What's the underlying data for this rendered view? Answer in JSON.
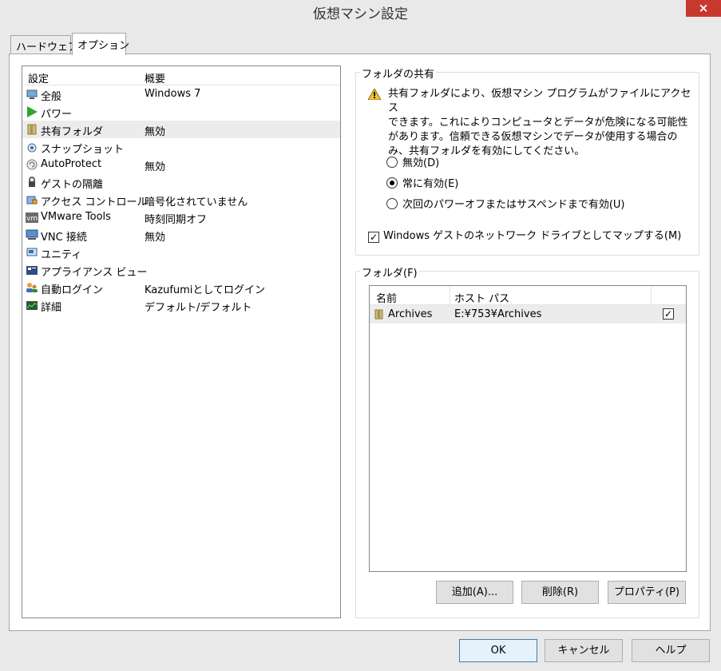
{
  "window": {
    "title": "仮想マシン設定",
    "close_label": "×"
  },
  "tabs": [
    {
      "label": "ハードウェア"
    },
    {
      "label": "オプション"
    }
  ],
  "settings": {
    "headers": {
      "setting": "設定",
      "summary": "概要"
    },
    "items": [
      {
        "name": "全般",
        "summary": "Windows 7",
        "icon": "monitor-icon"
      },
      {
        "name": "パワー",
        "summary": "",
        "icon": "play-icon"
      },
      {
        "name": "共有フォルダ",
        "summary": "無効",
        "icon": "folder-icon"
      },
      {
        "name": "スナップショット",
        "summary": "",
        "icon": "snapshot-icon"
      },
      {
        "name": "AutoProtect",
        "summary": "無効",
        "icon": "autoprotect-icon"
      },
      {
        "name": "ゲストの隔離",
        "summary": "",
        "icon": "lock-icon"
      },
      {
        "name": "アクセス コントロール",
        "summary": "暗号化されていません",
        "icon": "access-control-icon"
      },
      {
        "name": "VMware Tools",
        "summary": "時刻同期オフ",
        "icon": "vmware-tools-icon"
      },
      {
        "name": "VNC 接続",
        "summary": "無効",
        "icon": "vnc-icon"
      },
      {
        "name": "ユニティ",
        "summary": "",
        "icon": "unity-icon"
      },
      {
        "name": "アプライアンス ビュー",
        "summary": "",
        "icon": "appliance-icon"
      },
      {
        "name": "自動ログイン",
        "summary": "Kazufumiとしてログイン",
        "icon": "users-icon"
      },
      {
        "name": "詳細",
        "summary": "デフォルト/デフォルト",
        "icon": "advanced-icon"
      }
    ]
  },
  "folder_sharing": {
    "title": "フォルダの共有",
    "warning_lines": [
      "共有フォルダにより、仮想マシン プログラムがファイルにアクセス",
      "できます。これによりコンピュータとデータが危険になる可能性",
      "があります。信頼できる仮想マシンでデータが使用する場合の",
      "み、共有フォルダを有効にしてください。"
    ],
    "options": [
      {
        "label": "無効(D)",
        "checked": false
      },
      {
        "label": "常に有効(E)",
        "checked": true
      },
      {
        "label": "次回のパワーオフまたはサスペンドまで有効(U)",
        "checked": false
      }
    ],
    "map_drive_label": "Windows ゲストのネットワーク ドライブとしてマップする(M)",
    "map_drive_checked": true
  },
  "folders": {
    "title": "フォルダ(F)",
    "headers": {
      "name": "名前",
      "host_path": "ホスト パス"
    },
    "rows": [
      {
        "name": "Archives",
        "host_path": "E:¥753¥Archives",
        "enabled": true
      }
    ],
    "buttons": {
      "add": "追加(A)...",
      "remove": "削除(R)",
      "properties": "プロパティ(P)"
    }
  },
  "footer": {
    "ok": "OK",
    "cancel": "キャンセル",
    "help": "ヘルプ"
  },
  "colors": {
    "close": "#c7392f",
    "selected_row": "#ececec",
    "default_button": "#3c7fb1"
  }
}
